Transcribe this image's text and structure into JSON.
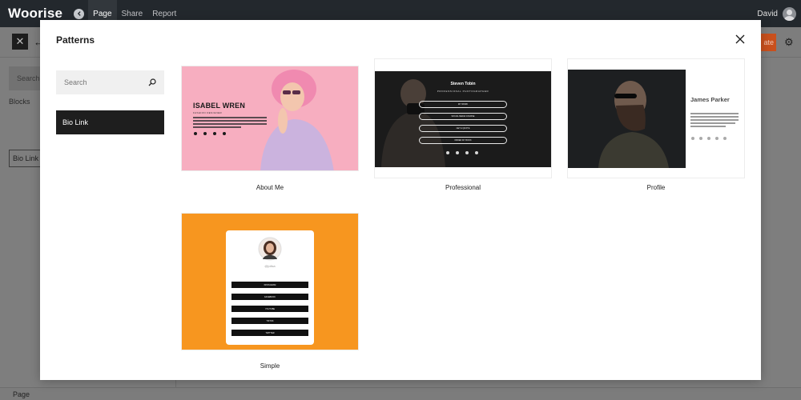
{
  "topbar": {
    "logo": "Woorise",
    "nav": [
      "Page",
      "Share",
      "Report"
    ],
    "active_nav": "Page",
    "user_name": "David"
  },
  "editor": {
    "publish_label": "ate",
    "search_placeholder": "Search",
    "blocks_label": "Blocks",
    "bio_link_block": "Bio Link",
    "status_text": "Page"
  },
  "modal": {
    "title": "Patterns",
    "search_placeholder": "Search",
    "categories": [
      "Bio Link"
    ],
    "active_category": "Bio Link",
    "patterns": [
      {
        "label": "About Me",
        "preview_name": "ISABEL WREN",
        "preview_subtitle": "FASHION DESIGNER"
      },
      {
        "label": "Professional",
        "preview_name": "Steven Tobin",
        "preview_subtitle": "PROFESSIONAL PHOTOGRAPHER",
        "buttons": [
          "MY WORK",
          "SOCIAL MEDIA COURSE",
          "GET A QUOTE",
          "ORDER MY BOOK"
        ]
      },
      {
        "label": "Profile",
        "preview_name": "James Parker"
      },
      {
        "label": "Simple",
        "preview_handle": "@jolisa",
        "buttons": [
          "INSTAGRAM",
          "FACEBOOK",
          "YOUTUBE",
          "TIKTOK",
          "TWITTER"
        ]
      }
    ]
  },
  "colors": {
    "topbar_bg": "#23282d",
    "modal_bg": "#ffffff",
    "category_active_bg": "#1e1e1e",
    "publish_accent": "#c9501d",
    "about_bg": "#f7aec0",
    "simple_bg": "#f7961f"
  }
}
